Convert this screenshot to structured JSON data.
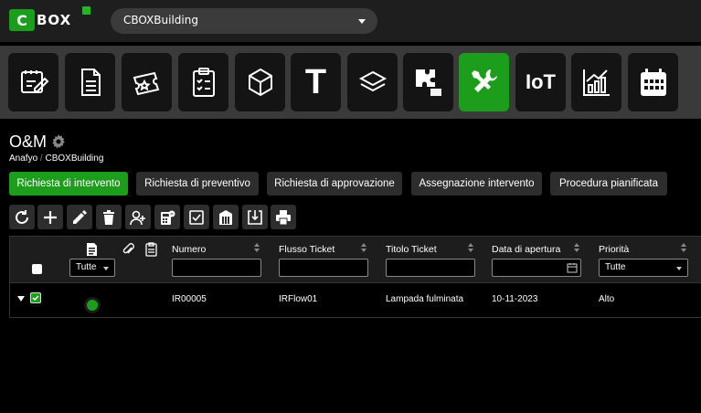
{
  "logo": {
    "letter": "C",
    "rest": "BOX"
  },
  "building": {
    "selected": "CBOXBuilding"
  },
  "modules": [
    {
      "name": "planner-icon"
    },
    {
      "name": "document-icon"
    },
    {
      "name": "tickets-icon"
    },
    {
      "name": "clipboard-icon"
    },
    {
      "name": "cube-icon"
    },
    {
      "name": "text-icon",
      "label": "T"
    },
    {
      "name": "layers-icon"
    },
    {
      "name": "puzzle-icon"
    },
    {
      "name": "tools-icon",
      "active": true
    },
    {
      "name": "iot-icon",
      "label": "IoT"
    },
    {
      "name": "chart-icon"
    },
    {
      "name": "calendar-icon"
    }
  ],
  "page": {
    "title": "O&M",
    "breadcrumb": {
      "root": "Anafyo",
      "sep": "/",
      "current": "CBOXBuilding"
    }
  },
  "tabs": [
    {
      "label": "Richiesta di intervento",
      "active": true
    },
    {
      "label": "Richiesta di preventivo"
    },
    {
      "label": "Richiesta di approvazione"
    },
    {
      "label": "Assegnazione intervento"
    },
    {
      "label": "Procedura pianificata"
    }
  ],
  "toolbar": [
    "refresh-icon",
    "add-icon",
    "edit-icon",
    "delete-icon",
    "assign-user-icon",
    "calculator-icon",
    "checklist-icon",
    "building-icon",
    "export-icon",
    "print-icon"
  ],
  "table": {
    "type_filter": "Tutte",
    "columns": {
      "numero": "Numero",
      "flusso": "Flusso Ticket",
      "titolo": "Titolo Ticket",
      "data": "Data di apertura",
      "priorita": "Priorità"
    },
    "priority_filter": "Tutte",
    "rows": [
      {
        "numero": "IR00005",
        "flusso": "IRFlow01",
        "titolo": "Lampada fulminata",
        "data": "10-11-2023",
        "priorita": "Alto",
        "status_color": "#1c9e1c"
      }
    ]
  },
  "colors": {
    "accent": "#1c9e1c",
    "panel": "#2d2d2d"
  }
}
